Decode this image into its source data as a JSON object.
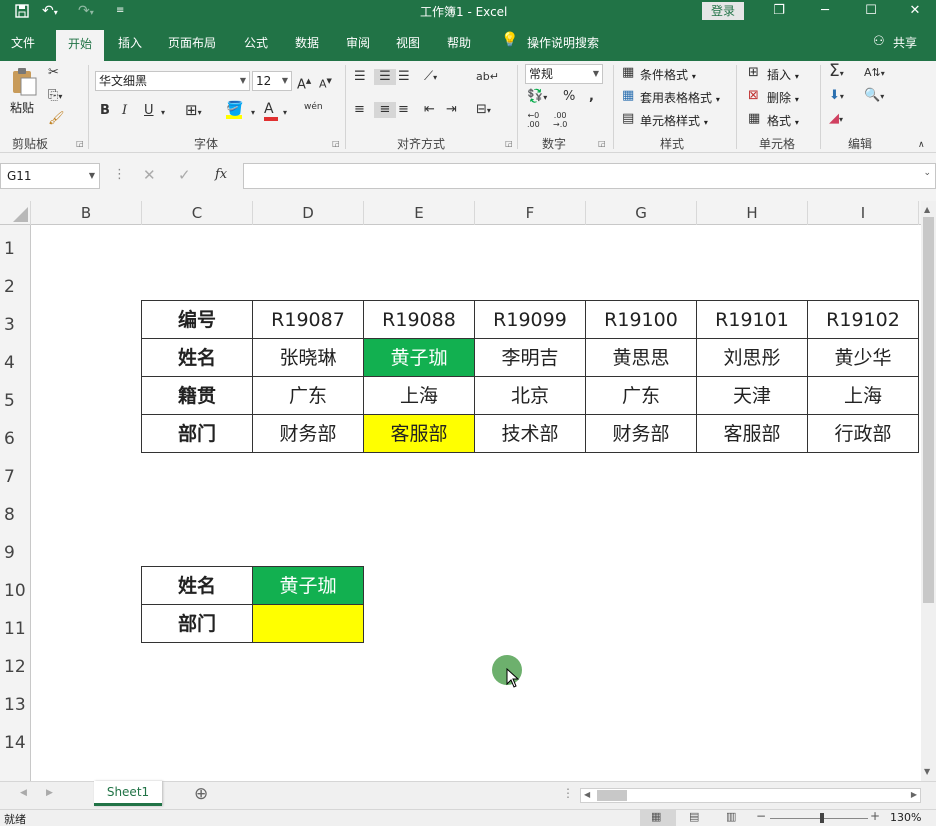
{
  "title": {
    "text": "工作簿1  -  Excel",
    "login": "登录"
  },
  "window": {
    "restore": "❐",
    "minimize": "─",
    "maximize": "☐",
    "close": "✕"
  },
  "menu": {
    "items": [
      "文件",
      "开始",
      "插入",
      "页面布局",
      "公式",
      "数据",
      "审阅",
      "视图",
      "帮助"
    ],
    "tell_me": "操作说明搜索",
    "share": "共享"
  },
  "ribbon": {
    "clipboard": {
      "paste": "粘贴",
      "label": "剪贴板"
    },
    "font": {
      "name": "华文细黑",
      "size": "12",
      "label": "字体",
      "bold": "B",
      "italic": "I",
      "underline": "U",
      "wen": "wén"
    },
    "alignment": {
      "label": "对齐方式"
    },
    "number": {
      "format": "常规",
      "label": "数字",
      "percent": "%",
      "comma": ","
    },
    "styles": {
      "conditional": "条件格式",
      "table": "套用表格格式",
      "cell": "单元格样式",
      "label": "样式"
    },
    "cells": {
      "insert": "插入",
      "delete": "删除",
      "format": "格式",
      "label": "单元格"
    },
    "editing": {
      "label": "编辑"
    }
  },
  "formula_bar": {
    "name_box": "G11",
    "formula": "",
    "fx": "fx"
  },
  "columns": [
    "B",
    "C",
    "D",
    "E",
    "F",
    "G",
    "H",
    "I"
  ],
  "rows": [
    "1",
    "2",
    "3",
    "4",
    "5",
    "6",
    "7",
    "8",
    "9",
    "10",
    "11",
    "12",
    "13",
    "14"
  ],
  "table1": {
    "rows": [
      [
        "编号",
        "R19087",
        "R19088",
        "R19099",
        "R19100",
        "R19101",
        "R19102"
      ],
      [
        "姓名",
        "张晓琳",
        "黄子珈",
        "李明吉",
        "黄思思",
        "刘思彤",
        "黄少华"
      ],
      [
        "籍贯",
        "广东",
        "上海",
        "北京",
        "广东",
        "天津",
        "上海"
      ],
      [
        "部门",
        "财务部",
        "客服部",
        "技术部",
        "财务部",
        "客服部",
        "行政部"
      ]
    ]
  },
  "table2": {
    "rows": [
      [
        "姓名",
        "黄子珈"
      ],
      [
        "部门",
        ""
      ]
    ]
  },
  "colors": {
    "accent": "#217346",
    "highlight_green": "#12b050",
    "highlight_yellow": "#ffff00"
  },
  "sheet": {
    "tab": "Sheet1",
    "add": "⊕"
  },
  "status": {
    "ready": "就绪",
    "zoom": "130%"
  }
}
